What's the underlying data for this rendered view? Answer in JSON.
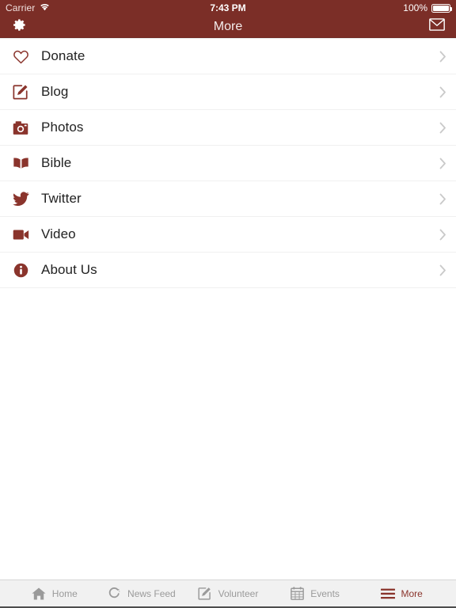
{
  "status_bar": {
    "carrier": "Carrier",
    "wifi_icon": "wifi-icon",
    "time": "7:43 PM",
    "battery_percent": "100%",
    "battery_icon": "battery-full-icon"
  },
  "navbar": {
    "title": "More",
    "left_icon": "gear-icon",
    "right_icon": "envelope-icon",
    "background_color": "#7B2E27",
    "title_color": "#F3ECEB"
  },
  "theme": {
    "accent": "#8A342C",
    "brand_dark": "#7B2E27",
    "list_text": "#222222",
    "tab_inactive": "#9A9A9A",
    "separator": "#F0F0F0"
  },
  "list": {
    "items": [
      {
        "label": "Donate",
        "icon": "heart-icon",
        "accessory": "chevron-right-icon"
      },
      {
        "label": "Blog",
        "icon": "pencil-square-icon",
        "accessory": "chevron-right-icon"
      },
      {
        "label": "Photos",
        "icon": "camera-icon",
        "accessory": "chevron-right-icon"
      },
      {
        "label": "Bible",
        "icon": "open-book-icon",
        "accessory": "chevron-right-icon"
      },
      {
        "label": "Twitter",
        "icon": "twitter-bird-icon",
        "accessory": "chevron-right-icon"
      },
      {
        "label": "Video",
        "icon": "video-camera-icon",
        "accessory": "chevron-right-icon"
      },
      {
        "label": "About Us",
        "icon": "info-circle-icon",
        "accessory": "chevron-right-icon"
      }
    ]
  },
  "tabbar": {
    "tabs": [
      {
        "label": "Home",
        "icon": "house-icon",
        "active": false
      },
      {
        "label": "News Feed",
        "icon": "refresh-circle-icon",
        "active": false
      },
      {
        "label": "Volunteer",
        "icon": "pencil-square-icon",
        "active": false
      },
      {
        "label": "Events",
        "icon": "calendar-icon",
        "active": false
      },
      {
        "label": "More",
        "icon": "hamburger-icon",
        "active": true
      }
    ]
  }
}
